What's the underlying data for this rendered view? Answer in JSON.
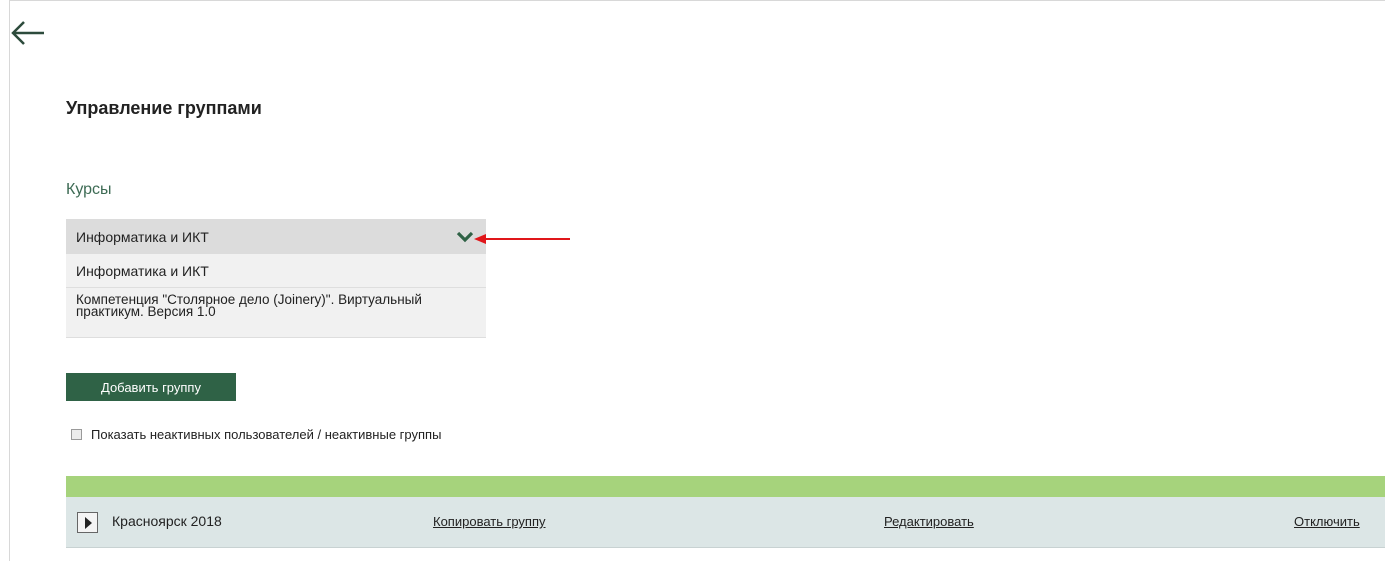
{
  "header": {
    "title": "Управление группами"
  },
  "courses": {
    "label": "Курсы",
    "selected": "Информатика и ИКТ",
    "options": [
      "Информатика и ИКТ",
      "Компетенция \"Столярное дело (Joinery)\". Виртуальный практикум. Версия 1.0"
    ]
  },
  "actions": {
    "add_group": "Добавить группу"
  },
  "filters": {
    "show_inactive": "Показать неактивных пользователей / неактивные группы",
    "show_inactive_checked": false
  },
  "groups": [
    {
      "name": "Красноярск 2018",
      "copy": "Копировать группу",
      "edit": "Редактировать",
      "disable": "Отключить"
    }
  ],
  "colors": {
    "accent": "#2f6246",
    "band": "#a6d37c",
    "row": "#dce6e6",
    "annotation": "#e0161a"
  },
  "icons": {
    "back": "arrow-left-icon",
    "dropdown": "chevron-down-icon",
    "expand": "play-icon",
    "annotation": "red-arrow-icon"
  }
}
